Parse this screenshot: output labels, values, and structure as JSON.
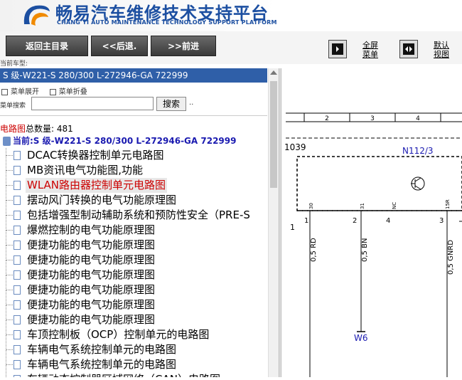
{
  "header": {
    "title_cn": "畅易汽车维修技术支持平台",
    "title_en": "CHANG YI AUTO MAINTENANCE TECHNOLOGY SUPPORT PLATFORM"
  },
  "toolbar": {
    "home_label": "返回主目录",
    "back_label": "<<后退.",
    "forward_label": ">>前进",
    "fullscreen_label_1": "全屏",
    "fullscreen_label_2": "菜单",
    "default_label_1": "默认",
    "default_label_2": "视图"
  },
  "sidebar": {
    "car_label": "当前车型:",
    "model": "S 级-W221-S 280/300 L-272946-GA 722999",
    "expand_label": "菜单展开",
    "collapse_label": "菜单折叠",
    "search_label": "菜单搜索",
    "search_value": "",
    "search_button": "搜索",
    "search_dots": "..",
    "count_prefix": "电路图",
    "count_text": "总数量: 481",
    "current_text": "当前:S 级-W221-S 280/300 L-272946-GA 722999",
    "items": [
      {
        "label": "DCAC转换器控制单元电路图"
      },
      {
        "label": "MB资讯电气功能图,功能"
      },
      {
        "label": "WLAN路由器控制单元电路图",
        "selected": true
      },
      {
        "label": "摆动风门转换的电气功能原理图"
      },
      {
        "label": "包括增强型制动辅助系统和预防性安全（PRE-S"
      },
      {
        "label": "爆燃控制的电气功能原理图"
      },
      {
        "label": "便捷功能的电气功能原理图"
      },
      {
        "label": "便捷功能的电气功能原理图"
      },
      {
        "label": "便捷功能的电气功能原理图"
      },
      {
        "label": "便捷功能的电气功能原理图"
      },
      {
        "label": "便捷功能的电气功能原理图"
      },
      {
        "label": "便捷功能的电气功能原理图"
      },
      {
        "label": "车顶控制板（OCP）控制单元的电路图"
      },
      {
        "label": "车辆电气系统控制单元的电路图"
      },
      {
        "label": "车辆电气系统控制单元的电路图"
      },
      {
        "label": "车辆动态控制器区域网络（CAN）电路图"
      }
    ]
  },
  "diagram": {
    "grid_numbers": [
      "2",
      "3",
      "4"
    ],
    "ref_number": "1039",
    "component": "N112/3",
    "pins_top": [
      "30",
      "31",
      "NC",
      "15R"
    ],
    "pins_num": [
      "1",
      "2",
      "4",
      "3"
    ],
    "side_number": "1",
    "wires": [
      "0,5 RD",
      "0,5 BN",
      "0,5 GNRD"
    ],
    "ground": "W6"
  }
}
